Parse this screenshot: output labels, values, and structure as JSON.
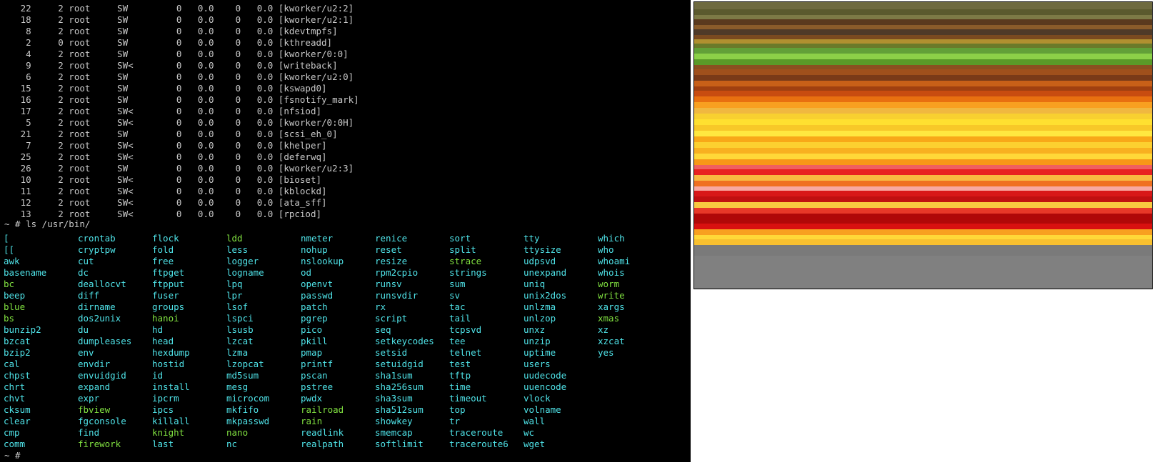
{
  "process_table": [
    {
      "pid": "22",
      "ppid": "2",
      "user": "root",
      "stat": "SW",
      "vsz": "0",
      "cpu": "0.0",
      "mem": "0",
      "time": "0.0",
      "cmd": "[kworker/u2:2]"
    },
    {
      "pid": "18",
      "ppid": "2",
      "user": "root",
      "stat": "SW",
      "vsz": "0",
      "cpu": "0.0",
      "mem": "0",
      "time": "0.0",
      "cmd": "[kworker/u2:1]"
    },
    {
      "pid": "8",
      "ppid": "2",
      "user": "root",
      "stat": "SW",
      "vsz": "0",
      "cpu": "0.0",
      "mem": "0",
      "time": "0.0",
      "cmd": "[kdevtmpfs]"
    },
    {
      "pid": "2",
      "ppid": "0",
      "user": "root",
      "stat": "SW",
      "vsz": "0",
      "cpu": "0.0",
      "mem": "0",
      "time": "0.0",
      "cmd": "[kthreadd]"
    },
    {
      "pid": "4",
      "ppid": "2",
      "user": "root",
      "stat": "SW",
      "vsz": "0",
      "cpu": "0.0",
      "mem": "0",
      "time": "0.0",
      "cmd": "[kworker/0:0]"
    },
    {
      "pid": "9",
      "ppid": "2",
      "user": "root",
      "stat": "SW<",
      "vsz": "0",
      "cpu": "0.0",
      "mem": "0",
      "time": "0.0",
      "cmd": "[writeback]"
    },
    {
      "pid": "6",
      "ppid": "2",
      "user": "root",
      "stat": "SW",
      "vsz": "0",
      "cpu": "0.0",
      "mem": "0",
      "time": "0.0",
      "cmd": "[kworker/u2:0]"
    },
    {
      "pid": "15",
      "ppid": "2",
      "user": "root",
      "stat": "SW",
      "vsz": "0",
      "cpu": "0.0",
      "mem": "0",
      "time": "0.0",
      "cmd": "[kswapd0]"
    },
    {
      "pid": "16",
      "ppid": "2",
      "user": "root",
      "stat": "SW",
      "vsz": "0",
      "cpu": "0.0",
      "mem": "0",
      "time": "0.0",
      "cmd": "[fsnotify_mark]"
    },
    {
      "pid": "17",
      "ppid": "2",
      "user": "root",
      "stat": "SW<",
      "vsz": "0",
      "cpu": "0.0",
      "mem": "0",
      "time": "0.0",
      "cmd": "[nfsiod]"
    },
    {
      "pid": "5",
      "ppid": "2",
      "user": "root",
      "stat": "SW<",
      "vsz": "0",
      "cpu": "0.0",
      "mem": "0",
      "time": "0.0",
      "cmd": "[kworker/0:0H]"
    },
    {
      "pid": "21",
      "ppid": "2",
      "user": "root",
      "stat": "SW",
      "vsz": "0",
      "cpu": "0.0",
      "mem": "0",
      "time": "0.0",
      "cmd": "[scsi_eh_0]"
    },
    {
      "pid": "7",
      "ppid": "2",
      "user": "root",
      "stat": "SW<",
      "vsz": "0",
      "cpu": "0.0",
      "mem": "0",
      "time": "0.0",
      "cmd": "[khelper]"
    },
    {
      "pid": "25",
      "ppid": "2",
      "user": "root",
      "stat": "SW<",
      "vsz": "0",
      "cpu": "0.0",
      "mem": "0",
      "time": "0.0",
      "cmd": "[deferwq]"
    },
    {
      "pid": "26",
      "ppid": "2",
      "user": "root",
      "stat": "SW",
      "vsz": "0",
      "cpu": "0.0",
      "mem": "0",
      "time": "0.0",
      "cmd": "[kworker/u2:3]"
    },
    {
      "pid": "10",
      "ppid": "2",
      "user": "root",
      "stat": "SW<",
      "vsz": "0",
      "cpu": "0.0",
      "mem": "0",
      "time": "0.0",
      "cmd": "[bioset]"
    },
    {
      "pid": "11",
      "ppid": "2",
      "user": "root",
      "stat": "SW<",
      "vsz": "0",
      "cpu": "0.0",
      "mem": "0",
      "time": "0.0",
      "cmd": "[kblockd]"
    },
    {
      "pid": "12",
      "ppid": "2",
      "user": "root",
      "stat": "SW<",
      "vsz": "0",
      "cpu": "0.0",
      "mem": "0",
      "time": "0.0",
      "cmd": "[ata_sff]"
    },
    {
      "pid": "13",
      "ppid": "2",
      "user": "root",
      "stat": "SW<",
      "vsz": "0",
      "cpu": "0.0",
      "mem": "0",
      "time": "0.0",
      "cmd": "[rpciod]"
    }
  ],
  "command_prompt": "~ # ls /usr/bin/",
  "final_prompt": "~ # ",
  "colors": {
    "terminal_bg": "#000000",
    "text": "#c8c8c8",
    "ls_file": "#4fe3e8",
    "ls_exec": "#80e040"
  },
  "ls_listing": [
    {
      "name": "[",
      "exec": false
    },
    {
      "name": "[[",
      "exec": false
    },
    {
      "name": "awk",
      "exec": false
    },
    {
      "name": "basename",
      "exec": false
    },
    {
      "name": "bc",
      "exec": true
    },
    {
      "name": "beep",
      "exec": false
    },
    {
      "name": "blue",
      "exec": true
    },
    {
      "name": "bs",
      "exec": true
    },
    {
      "name": "bunzip2",
      "exec": false
    },
    {
      "name": "bzcat",
      "exec": false
    },
    {
      "name": "bzip2",
      "exec": false
    },
    {
      "name": "cal",
      "exec": false
    },
    {
      "name": "chpst",
      "exec": false
    },
    {
      "name": "chrt",
      "exec": false
    },
    {
      "name": "chvt",
      "exec": false
    },
    {
      "name": "cksum",
      "exec": false
    },
    {
      "name": "clear",
      "exec": false
    },
    {
      "name": "cmp",
      "exec": false
    },
    {
      "name": "comm",
      "exec": false
    },
    {
      "name": "crontab",
      "exec": false
    },
    {
      "name": "cryptpw",
      "exec": false
    },
    {
      "name": "cut",
      "exec": false
    },
    {
      "name": "dc",
      "exec": false
    },
    {
      "name": "deallocvt",
      "exec": false
    },
    {
      "name": "diff",
      "exec": false
    },
    {
      "name": "dirname",
      "exec": false
    },
    {
      "name": "dos2unix",
      "exec": false
    },
    {
      "name": "du",
      "exec": false
    },
    {
      "name": "dumpleases",
      "exec": false
    },
    {
      "name": "env",
      "exec": false
    },
    {
      "name": "envdir",
      "exec": false
    },
    {
      "name": "envuidgid",
      "exec": false
    },
    {
      "name": "expand",
      "exec": false
    },
    {
      "name": "expr",
      "exec": false
    },
    {
      "name": "fbview",
      "exec": true
    },
    {
      "name": "fgconsole",
      "exec": false
    },
    {
      "name": "find",
      "exec": false
    },
    {
      "name": "firework",
      "exec": true
    },
    {
      "name": "flock",
      "exec": false
    },
    {
      "name": "fold",
      "exec": false
    },
    {
      "name": "free",
      "exec": false
    },
    {
      "name": "ftpget",
      "exec": false
    },
    {
      "name": "ftpput",
      "exec": false
    },
    {
      "name": "fuser",
      "exec": false
    },
    {
      "name": "groups",
      "exec": false
    },
    {
      "name": "hanoi",
      "exec": true
    },
    {
      "name": "hd",
      "exec": false
    },
    {
      "name": "head",
      "exec": false
    },
    {
      "name": "hexdump",
      "exec": false
    },
    {
      "name": "hostid",
      "exec": false
    },
    {
      "name": "id",
      "exec": false
    },
    {
      "name": "install",
      "exec": false
    },
    {
      "name": "ipcrm",
      "exec": false
    },
    {
      "name": "ipcs",
      "exec": false
    },
    {
      "name": "killall",
      "exec": false
    },
    {
      "name": "knight",
      "exec": true
    },
    {
      "name": "last",
      "exec": false
    },
    {
      "name": "ldd",
      "exec": true
    },
    {
      "name": "less",
      "exec": false
    },
    {
      "name": "logger",
      "exec": false
    },
    {
      "name": "logname",
      "exec": false
    },
    {
      "name": "lpq",
      "exec": false
    },
    {
      "name": "lpr",
      "exec": false
    },
    {
      "name": "lsof",
      "exec": false
    },
    {
      "name": "lspci",
      "exec": false
    },
    {
      "name": "lsusb",
      "exec": false
    },
    {
      "name": "lzcat",
      "exec": false
    },
    {
      "name": "lzma",
      "exec": false
    },
    {
      "name": "lzopcat",
      "exec": false
    },
    {
      "name": "md5sum",
      "exec": false
    },
    {
      "name": "mesg",
      "exec": false
    },
    {
      "name": "microcom",
      "exec": false
    },
    {
      "name": "mkfifo",
      "exec": false
    },
    {
      "name": "mkpasswd",
      "exec": false
    },
    {
      "name": "nano",
      "exec": true
    },
    {
      "name": "nc",
      "exec": false
    },
    {
      "name": "nmeter",
      "exec": false
    },
    {
      "name": "nohup",
      "exec": false
    },
    {
      "name": "nslookup",
      "exec": false
    },
    {
      "name": "od",
      "exec": false
    },
    {
      "name": "openvt",
      "exec": false
    },
    {
      "name": "passwd",
      "exec": false
    },
    {
      "name": "patch",
      "exec": false
    },
    {
      "name": "pgrep",
      "exec": false
    },
    {
      "name": "pico",
      "exec": false
    },
    {
      "name": "pkill",
      "exec": false
    },
    {
      "name": "pmap",
      "exec": false
    },
    {
      "name": "printf",
      "exec": false
    },
    {
      "name": "pscan",
      "exec": false
    },
    {
      "name": "pstree",
      "exec": false
    },
    {
      "name": "pwdx",
      "exec": false
    },
    {
      "name": "railroad",
      "exec": true
    },
    {
      "name": "rain",
      "exec": true
    },
    {
      "name": "readlink",
      "exec": false
    },
    {
      "name": "realpath",
      "exec": false
    },
    {
      "name": "renice",
      "exec": false
    },
    {
      "name": "reset",
      "exec": false
    },
    {
      "name": "resize",
      "exec": false
    },
    {
      "name": "rpm2cpio",
      "exec": false
    },
    {
      "name": "runsv",
      "exec": false
    },
    {
      "name": "runsvdir",
      "exec": false
    },
    {
      "name": "rx",
      "exec": false
    },
    {
      "name": "script",
      "exec": false
    },
    {
      "name": "seq",
      "exec": false
    },
    {
      "name": "setkeycodes",
      "exec": false
    },
    {
      "name": "setsid",
      "exec": false
    },
    {
      "name": "setuidgid",
      "exec": false
    },
    {
      "name": "sha1sum",
      "exec": false
    },
    {
      "name": "sha256sum",
      "exec": false
    },
    {
      "name": "sha3sum",
      "exec": false
    },
    {
      "name": "sha512sum",
      "exec": false
    },
    {
      "name": "showkey",
      "exec": false
    },
    {
      "name": "smemcap",
      "exec": false
    },
    {
      "name": "softlimit",
      "exec": false
    },
    {
      "name": "sort",
      "exec": false
    },
    {
      "name": "split",
      "exec": false
    },
    {
      "name": "strace",
      "exec": true
    },
    {
      "name": "strings",
      "exec": false
    },
    {
      "name": "sum",
      "exec": false
    },
    {
      "name": "sv",
      "exec": false
    },
    {
      "name": "tac",
      "exec": false
    },
    {
      "name": "tail",
      "exec": false
    },
    {
      "name": "tcpsvd",
      "exec": false
    },
    {
      "name": "tee",
      "exec": false
    },
    {
      "name": "telnet",
      "exec": false
    },
    {
      "name": "test",
      "exec": false
    },
    {
      "name": "tftp",
      "exec": false
    },
    {
      "name": "time",
      "exec": false
    },
    {
      "name": "timeout",
      "exec": false
    },
    {
      "name": "top",
      "exec": false
    },
    {
      "name": "tr",
      "exec": false
    },
    {
      "name": "traceroute",
      "exec": false
    },
    {
      "name": "traceroute6",
      "exec": false
    },
    {
      "name": "tty",
      "exec": false
    },
    {
      "name": "ttysize",
      "exec": false
    },
    {
      "name": "udpsvd",
      "exec": false
    },
    {
      "name": "unexpand",
      "exec": false
    },
    {
      "name": "uniq",
      "exec": false
    },
    {
      "name": "unix2dos",
      "exec": false
    },
    {
      "name": "unlzma",
      "exec": false
    },
    {
      "name": "unlzop",
      "exec": false
    },
    {
      "name": "unxz",
      "exec": false
    },
    {
      "name": "unzip",
      "exec": false
    },
    {
      "name": "uptime",
      "exec": false
    },
    {
      "name": "users",
      "exec": false
    },
    {
      "name": "uudecode",
      "exec": false
    },
    {
      "name": "uuencode",
      "exec": false
    },
    {
      "name": "vlock",
      "exec": false
    },
    {
      "name": "volname",
      "exec": false
    },
    {
      "name": "wall",
      "exec": false
    },
    {
      "name": "wc",
      "exec": false
    },
    {
      "name": "wget",
      "exec": false
    },
    {
      "name": "which",
      "exec": false
    },
    {
      "name": "who",
      "exec": false
    },
    {
      "name": "whoami",
      "exec": false
    },
    {
      "name": "whois",
      "exec": false
    },
    {
      "name": "worm",
      "exec": true
    },
    {
      "name": "write",
      "exec": true
    },
    {
      "name": "xargs",
      "exec": false
    },
    {
      "name": "xmas",
      "exec": true
    },
    {
      "name": "xz",
      "exec": false
    },
    {
      "name": "xzcat",
      "exec": false
    },
    {
      "name": "yes",
      "exec": false
    }
  ],
  "preview_stripes": [
    {
      "color": "#6e6a40",
      "h": 10
    },
    {
      "color": "#5b5a2e",
      "h": 8
    },
    {
      "color": "#7d7a46",
      "h": 6
    },
    {
      "color": "#5a3a1e",
      "h": 8
    },
    {
      "color": "#8a5c2a",
      "h": 6
    },
    {
      "color": "#4f3a28",
      "h": 8
    },
    {
      "color": "#7a4a20",
      "h": 6
    },
    {
      "color": "#b09030",
      "h": 6
    },
    {
      "color": "#6a7a2a",
      "h": 6
    },
    {
      "color": "#62a038",
      "h": 8
    },
    {
      "color": "#8cd048",
      "h": 8
    },
    {
      "color": "#5a9a28",
      "h": 8
    },
    {
      "color": "#8a5020",
      "h": 6
    },
    {
      "color": "#a0501c",
      "h": 8
    },
    {
      "color": "#7a3a18",
      "h": 8
    },
    {
      "color": "#c86018",
      "h": 8
    },
    {
      "color": "#a04010",
      "h": 6
    },
    {
      "color": "#c84c10",
      "h": 8
    },
    {
      "color": "#e87010",
      "h": 8
    },
    {
      "color": "#f8a020",
      "h": 8
    },
    {
      "color": "#f0b840",
      "h": 8
    },
    {
      "color": "#f8d030",
      "h": 8
    },
    {
      "color": "#ffe030",
      "h": 8
    },
    {
      "color": "#f8c828",
      "h": 8
    },
    {
      "color": "#ffe840",
      "h": 8
    },
    {
      "color": "#f8a818",
      "h": 8
    },
    {
      "color": "#fcd030",
      "h": 8
    },
    {
      "color": "#f8b020",
      "h": 8
    },
    {
      "color": "#ffd838",
      "h": 8
    },
    {
      "color": "#f89818",
      "h": 8
    },
    {
      "color": "#f06060",
      "h": 6
    },
    {
      "color": "#e82020",
      "h": 8
    },
    {
      "color": "#f8b840",
      "h": 8
    },
    {
      "color": "#f07020",
      "h": 8
    },
    {
      "color": "#f8a8a0",
      "h": 6
    },
    {
      "color": "#d81818",
      "h": 8
    },
    {
      "color": "#c01010",
      "h": 8
    },
    {
      "color": "#f8c840",
      "h": 8
    },
    {
      "color": "#e83828",
      "h": 8
    },
    {
      "color": "#b00808",
      "h": 14
    },
    {
      "color": "#d81010",
      "h": 8
    },
    {
      "color": "#f8a020",
      "h": 8
    },
    {
      "color": "#ffd838",
      "h": 6
    },
    {
      "color": "#f8c030",
      "h": 8
    },
    {
      "color": "#7a7a7a",
      "h": 14
    }
  ]
}
